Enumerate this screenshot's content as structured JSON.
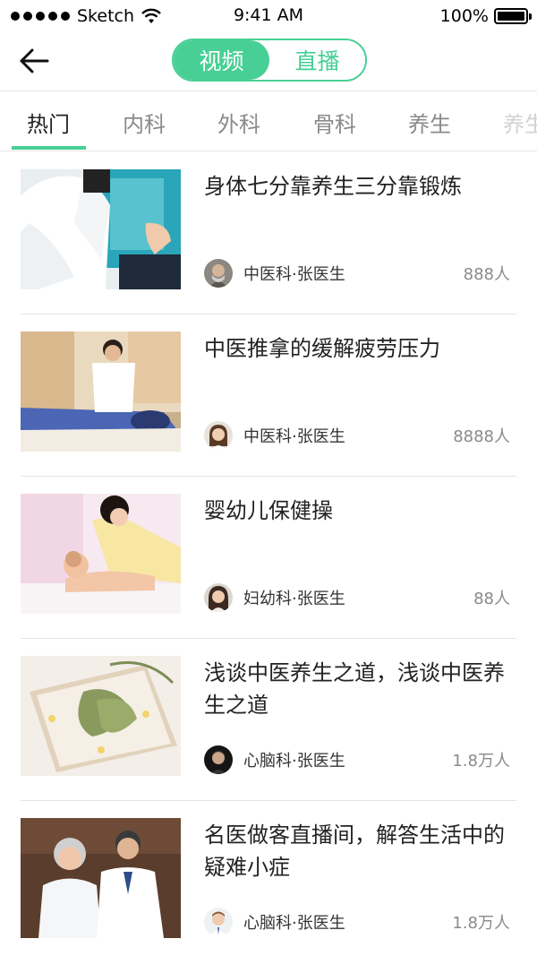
{
  "status_bar": {
    "carrier": "Sketch",
    "time": "9:41 AM",
    "battery": "100%",
    "icons": [
      "signal-dots-icon",
      "wifi-icon",
      "battery-icon"
    ]
  },
  "nav": {
    "back_icon": "arrow-left-icon",
    "segments": [
      {
        "label": "视频",
        "active": true
      },
      {
        "label": "直播",
        "active": false
      }
    ]
  },
  "tabs": {
    "items": [
      {
        "label": "热门",
        "active": true
      },
      {
        "label": "内科",
        "active": false
      },
      {
        "label": "外科",
        "active": false
      },
      {
        "label": "骨科",
        "active": false
      },
      {
        "label": "养生",
        "active": false
      },
      {
        "label": "养生",
        "active": false
      }
    ]
  },
  "colors": {
    "accent": "#48cf95",
    "text_primary": "#222222",
    "text_secondary": "#8a8a8a",
    "divider": "#e4e4e4"
  },
  "videos": [
    {
      "title": "身体七分靠养生三分靠锻炼",
      "doctor": "中医科·张医生",
      "count": "888人"
    },
    {
      "title": "中医推拿的缓解疲劳压力",
      "doctor": "中医科·张医生",
      "count": "8888人"
    },
    {
      "title": "婴幼儿保健操",
      "doctor": "妇幼科·张医生",
      "count": "88人"
    },
    {
      "title": "浅谈中医养生之道，浅谈中医养生之道",
      "doctor": "心脑科·张医生",
      "count": "1.8万人"
    },
    {
      "title": "名医做客直播间，解答生活中的疑难小症",
      "doctor": "心脑科·张医生",
      "count": "1.8万人"
    }
  ]
}
